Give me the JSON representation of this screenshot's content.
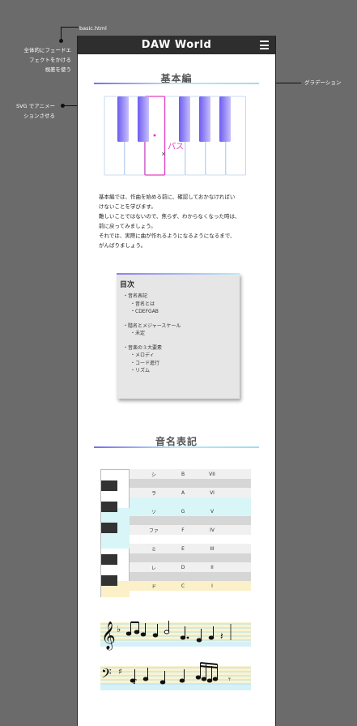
{
  "annotations": {
    "file": "basic.html",
    "fade": [
      "全体的にフェードエ",
      "フェクトをかける",
      "視差を使う"
    ],
    "svg": [
      "SVG でアニメー",
      "ションさせる"
    ],
    "gradation": "グラデーション"
  },
  "header": {
    "title": "DAW World"
  },
  "section1": {
    "heading": "基本編",
    "piano_label": "パス",
    "body": [
      "基本編では、作曲を始める前に、確認しておかなければい",
      "けないことを学びます。",
      "難しいことではないので、焦らず、わからなくなった時は、",
      "前に戻ってみましょう。",
      "それでは、実際に曲が作れるようになるようになるまで、",
      "がんばりましょう。"
    ]
  },
  "toc": {
    "title": "目次",
    "items": [
      {
        "text": "・音名表記",
        "sub": false
      },
      {
        "text": "・音名とは",
        "sub": true
      },
      {
        "text": "・CDEFGAB",
        "sub": true
      },
      {
        "text": "",
        "sub": false
      },
      {
        "text": "・階名とメジャースケール",
        "sub": false
      },
      {
        "text": "・未定",
        "sub": true
      },
      {
        "text": "",
        "sub": false
      },
      {
        "text": "・音楽の３大要素",
        "sub": false
      },
      {
        "text": "・メロディ",
        "sub": true
      },
      {
        "text": "・コード進行",
        "sub": true
      },
      {
        "text": "・リズム",
        "sub": true
      }
    ]
  },
  "section2": {
    "heading": "音名表記",
    "rows": [
      {
        "solfege": "シ",
        "letter": "B",
        "roman": "VII"
      },
      {
        "solfege": "ラ",
        "letter": "A",
        "roman": "VI"
      },
      {
        "solfege": "ソ",
        "letter": "G",
        "roman": "V"
      },
      {
        "solfege": "ファ",
        "letter": "F",
        "roman": "IV"
      },
      {
        "solfege": "ミ",
        "letter": "E",
        "roman": "III"
      },
      {
        "solfege": "レ",
        "letter": "D",
        "roman": "II"
      },
      {
        "solfege": "ド",
        "letter": "C",
        "roman": "I"
      }
    ]
  },
  "colors": {
    "accent1": "#7a6cf0",
    "accent2": "#b7e9f5",
    "label": "#e040c0"
  }
}
